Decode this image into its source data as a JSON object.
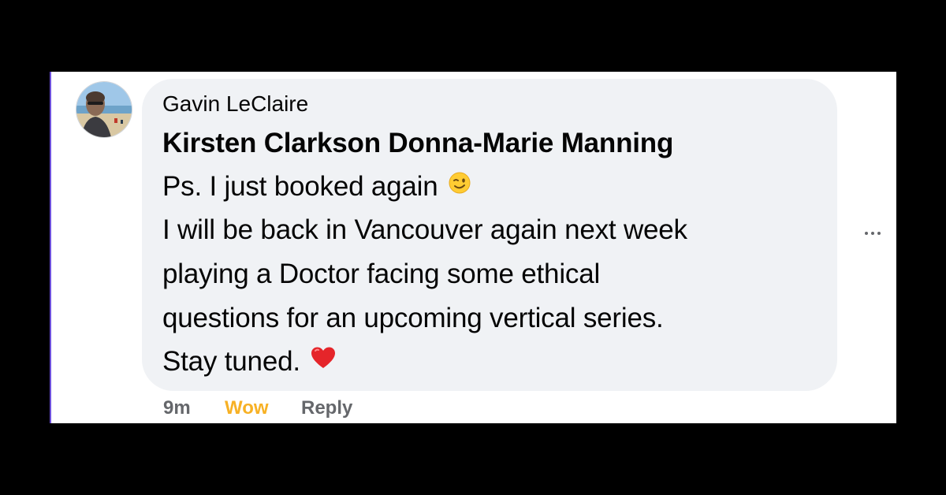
{
  "comment": {
    "author": "Gavin LeClaire",
    "mentions": "Kirsten Clarkson Donna-Marie Manning",
    "lines": [
      "Ps. I just booked again",
      "I will be back in Vancouver again next week",
      "playing a Doctor facing some ethical",
      "questions for an upcoming vertical series.",
      "Stay tuned."
    ],
    "emojis": [
      "winking-face-emoji",
      "red-heart-emoji"
    ],
    "time": "9m",
    "reaction_label": "Wow",
    "reply_label": "Reply",
    "more_icon": "more-options-icon"
  },
  "colors": {
    "background": "#000000",
    "bubble": "#f0f2f5",
    "text": "#050505",
    "secondary": "#65676b",
    "wow": "#f7b125"
  }
}
